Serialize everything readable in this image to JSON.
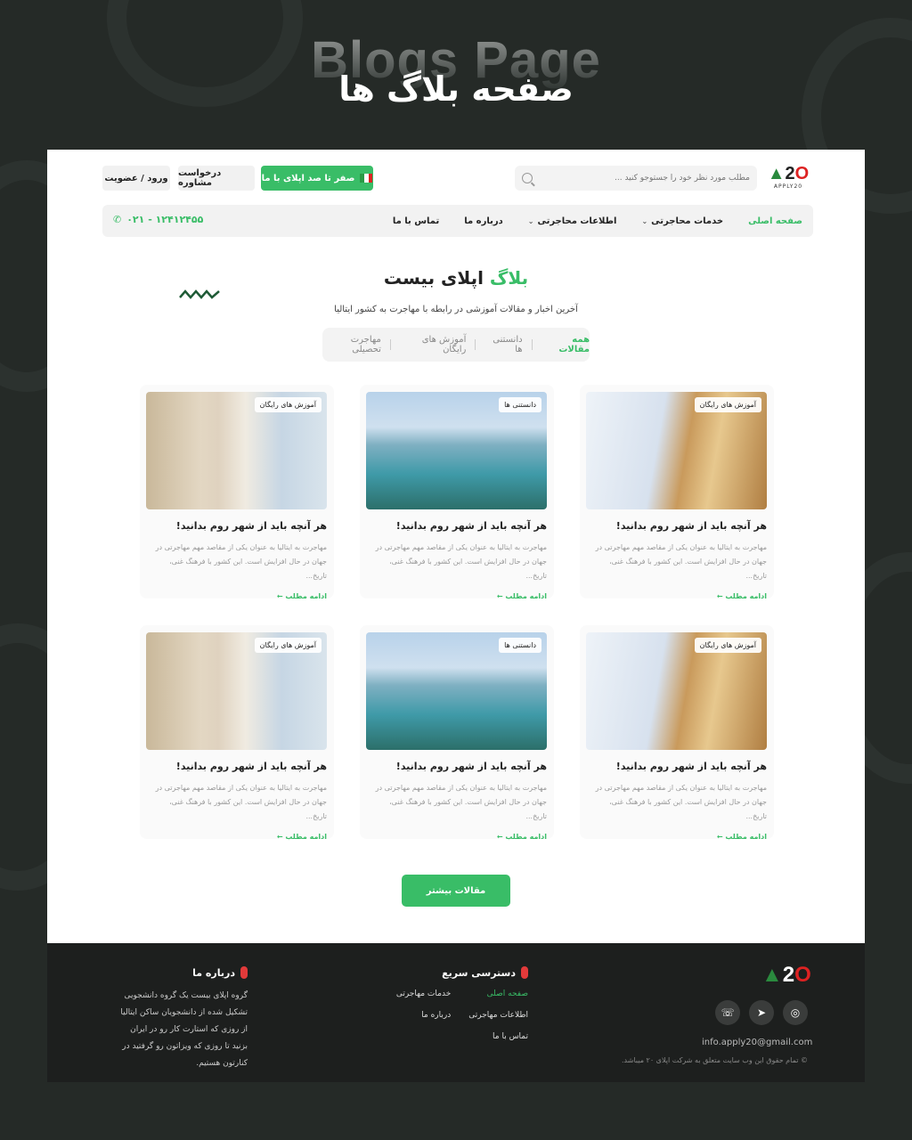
{
  "showcase": {
    "title_en": "Blogs Page",
    "title_fa": "صفحه بلاگ ها"
  },
  "topbar": {
    "logo_text": "A20",
    "logo_sub": "APPLY20",
    "search_placeholder": "مطلب مورد نظر خود را جستوجو کنید ...",
    "cta_label": "صفر تا صد اپلای با ما",
    "consult_label": "درخواست مشاوره",
    "auth_label": "ورود / عضویت"
  },
  "nav": {
    "items": [
      {
        "label": "صفحه اصلی",
        "active": true
      },
      {
        "label": "خدمات محاجرتی",
        "dropdown": true
      },
      {
        "label": "اطلاعات محاجرتی",
        "dropdown": true
      },
      {
        "label": "درباره ما"
      },
      {
        "label": "تماس با ما"
      }
    ],
    "phone": "۰۲۱ - ۱۲۴۱۲۴۵۵"
  },
  "hero": {
    "title_green": "بلاگ",
    "title_rest": "اپلای بیست",
    "subtitle": "آخرین اخبار و مقالات آموزشی در رابطه با مهاجرت به کشور ایتالیا"
  },
  "filters": [
    "همه مقالات",
    "دانستنی ها",
    "آموزش های رایگان",
    "مهاجرت تحصیلی"
  ],
  "cards": [
    {
      "badge": "آموزش های رایگان",
      "title": "هر آنچه باید از شهر روم بدانید!",
      "excerpt": "مهاجرت به ایتالیا به عنوان یکی از مقاصد مهم مهاجرتی در جهان در حال افزایش است. این کشور با فرهنگ غنی، تاریخ...",
      "more": "ادامه مطلب",
      "image": "tower-close"
    },
    {
      "badge": "دانستنی ها",
      "title": "هر آنچه باید از شهر روم بدانید!",
      "excerpt": "مهاجرت به ایتالیا به عنوان یکی از مقاصد مهم مهاجرتی در جهان در حال افزایش است. این کشور با فرهنگ غنی، تاریخ...",
      "more": "ادامه مطلب",
      "image": "lake"
    },
    {
      "badge": "آموزش های رایگان",
      "title": "هر آنچه باید از شهر روم بدانید!",
      "excerpt": "مهاجرت به ایتالیا به عنوان یکی از مقاصد مهم مهاجرتی در جهان در حال افزایش است. این کشور با فرهنگ غنی، تاریخ...",
      "more": "ادامه مطلب",
      "image": "pisa"
    },
    {
      "badge": "آموزش های رایگان",
      "title": "هر آنچه باید از شهر روم بدانید!",
      "excerpt": "مهاجرت به ایتالیا به عنوان یکی از مقاصد مهم مهاجرتی در جهان در حال افزایش است. این کشور با فرهنگ غنی، تاریخ...",
      "more": "ادامه مطلب",
      "image": "tower-close"
    },
    {
      "badge": "دانستنی ها",
      "title": "هر آنچه باید از شهر روم بدانید!",
      "excerpt": "مهاجرت به ایتالیا به عنوان یکی از مقاصد مهم مهاجرتی در جهان در حال افزایش است. این کشور با فرهنگ غنی، تاریخ...",
      "more": "ادامه مطلب",
      "image": "lake"
    },
    {
      "badge": "آموزش های رایگان",
      "title": "هر آنچه باید از شهر روم بدانید!",
      "excerpt": "مهاجرت به ایتالیا به عنوان یکی از مقاصد مهم مهاجرتی در جهان در حال افزایش است. این کشور با فرهنگ غنی، تاریخ...",
      "more": "ادامه مطلب",
      "image": "pisa"
    }
  ],
  "load_more": "مقالات بیشتر",
  "footer": {
    "about_title": "درباره ما",
    "about_text": "گروه اپلای بیست یک گروه دانشجویی تشکیل شده از دانشجویان ساکن ایتالیا از روزی که استارت کار رو در ایران بزنید تا روزی که ویزاتون رو گرفتید در کنارتون هستیم.",
    "quick_title": "دسترسی سریع",
    "quick_links": [
      {
        "label": "صفحه اصلی",
        "active": true
      },
      {
        "label": "خدمات مهاجرتی"
      },
      {
        "label": "اطلاعات مهاجرتی"
      },
      {
        "label": "درباره ما"
      },
      {
        "label": "تماس با ما"
      }
    ],
    "email": "info.apply20@gmail.com",
    "copyright": "© تمام حقوق این وب سایت متعلق به شرکت اپلای ۲۰ میباشد.",
    "socials": [
      "whatsapp-icon",
      "telegram-icon",
      "instagram-icon"
    ]
  },
  "colors": {
    "accent": "#39bd67",
    "dark_bg": "#252a27",
    "footer_bg": "#1d1f1e",
    "logo_red": "#dd2222"
  }
}
